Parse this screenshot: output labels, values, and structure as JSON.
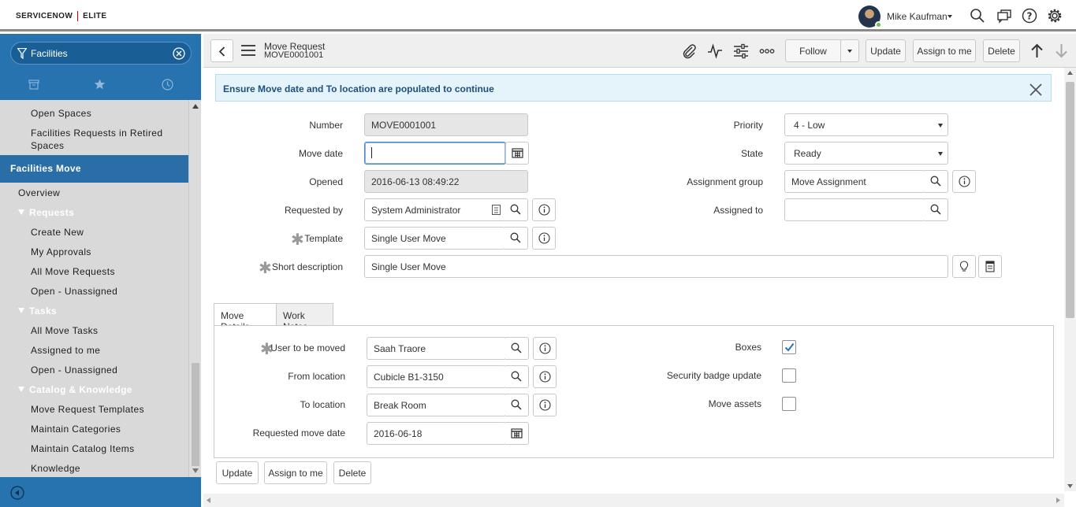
{
  "header": {
    "brand_left": "SERVICENOW",
    "brand_right": "ELITE",
    "user_name": "Mike Kaufman"
  },
  "nav": {
    "filter_value": "Facilities",
    "items_before": [
      {
        "label": "Open Spaces"
      },
      {
        "label": "Facilities Requests in Retired"
      },
      {
        "label": "Spaces"
      }
    ],
    "section": "Facilities Move",
    "overview": "Overview",
    "groups": [
      {
        "label": "Requests",
        "items": [
          "Create New",
          "My Approvals",
          "All Move Requests",
          "Open - Unassigned"
        ]
      },
      {
        "label": "Tasks",
        "items": [
          "All Move Tasks",
          "Assigned to me",
          "Open - Unassigned"
        ]
      },
      {
        "label": "Catalog & Knowledge",
        "items": [
          "Move Request Templates",
          "Maintain Categories",
          "Maintain Catalog Items",
          "Knowledge"
        ]
      }
    ]
  },
  "form": {
    "record_type": "Move Request",
    "record_number": "MOVE0001001",
    "toolbar": {
      "follow": "Follow",
      "update": "Update",
      "assign_to_me": "Assign to me",
      "delete": "Delete"
    },
    "alert": "Ensure Move date and To location are populated to continue",
    "left_fields": {
      "number_label": "Number",
      "number_value": "MOVE0001001",
      "move_date_label": "Move date",
      "move_date_value": "",
      "opened_label": "Opened",
      "opened_value": "2016-06-13 08:49:22",
      "requested_by_label": "Requested by",
      "requested_by_value": "System Administrator",
      "template_label": "Template",
      "template_value": "Single User Move",
      "short_desc_label": "Short description",
      "short_desc_value": "Single User Move"
    },
    "right_fields": {
      "priority_label": "Priority",
      "priority_value": "4 - Low",
      "state_label": "State",
      "state_value": "Ready",
      "assignment_group_label": "Assignment group",
      "assignment_group_value": "Move Assignment",
      "assigned_to_label": "Assigned to",
      "assigned_to_value": ""
    },
    "tabs": [
      "Move Details",
      "Work Notes"
    ],
    "move_details": {
      "user_label": "User to be moved",
      "user_value": "Saah Traore",
      "from_label": "From location",
      "from_value": "Cubicle B1-3150",
      "to_label": "To location",
      "to_value": "Break Room",
      "req_date_label": "Requested move date",
      "req_date_value": "2016-06-18",
      "boxes_label": "Boxes",
      "boxes_checked": true,
      "badge_label": "Security badge update",
      "badge_checked": false,
      "assets_label": "Move assets",
      "assets_checked": false
    },
    "bottom_buttons": {
      "update": "Update",
      "assign_to_me": "Assign to me",
      "delete": "Delete"
    }
  },
  "colors": {
    "accent": "#2673b0",
    "nav_bg": "#d9d9d9",
    "alert_bg": "#e5f4fb",
    "alert_text": "#1f4f7b"
  }
}
